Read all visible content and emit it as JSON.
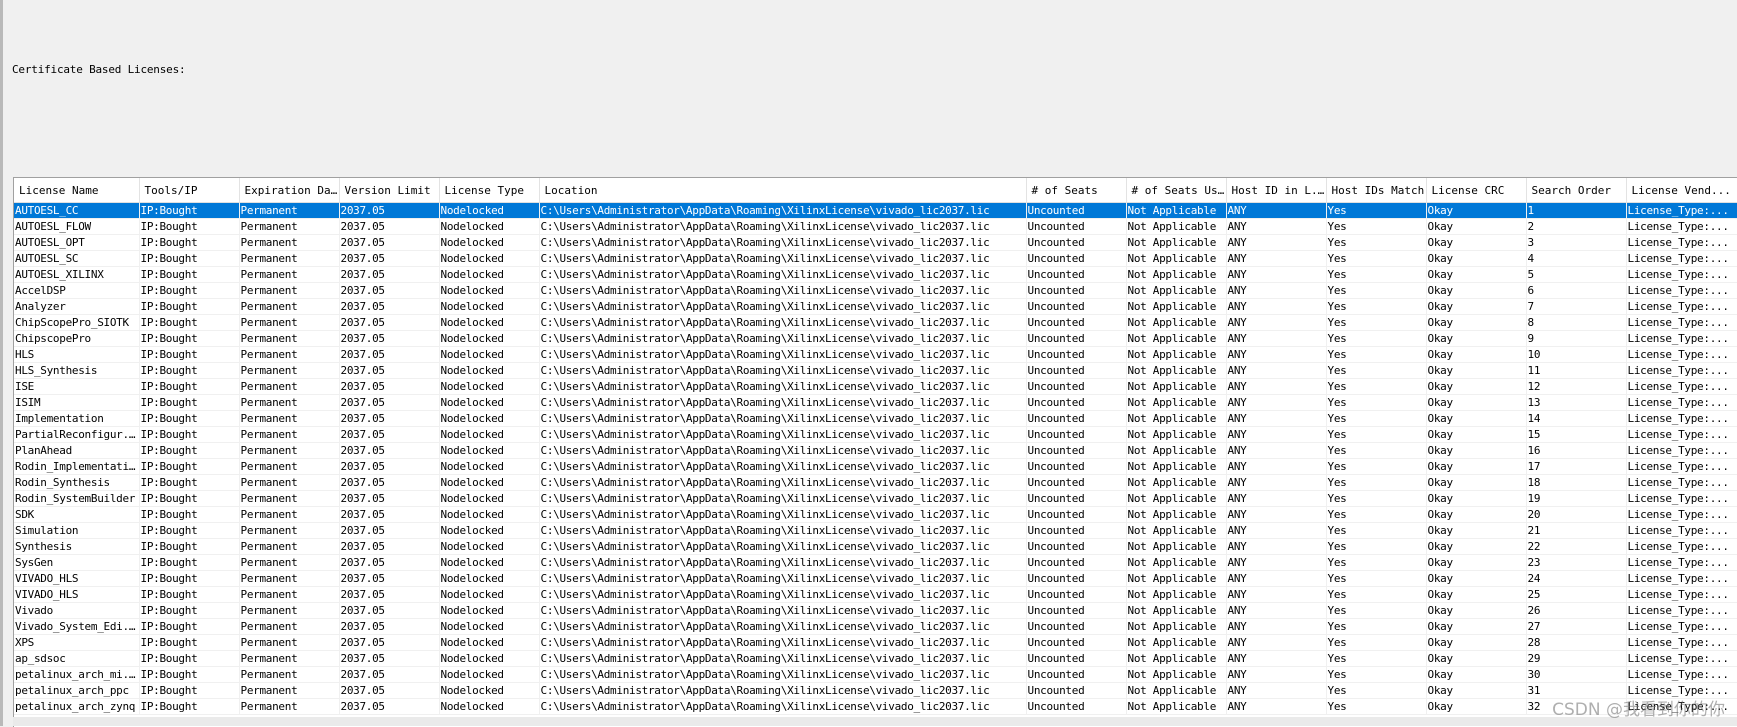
{
  "section_label": "Certificate Based Licenses:",
  "columns": [
    "License Name",
    "Tools/IP",
    "Expiration Date",
    "Version Limit",
    "License Type",
    "Location",
    "# of Seats",
    "# of Seats Used",
    "Host ID in L...",
    "Host IDs Match",
    "License CRC",
    "Search Order",
    "License Vend..."
  ],
  "row_defaults": {
    "tools": "IP:Bought",
    "expiration": "Permanent",
    "version": "2037.05",
    "type": "Nodelocked",
    "location": "C:\\Users\\Administrator\\AppData\\Roaming\\XilinxLicense\\vivado_lic2037.lic",
    "seats": "Uncounted",
    "seats_used": "Not Applicable",
    "host_id": "ANY",
    "host_match": "Yes",
    "crc": "Okay",
    "vendor": "License_Type:..."
  },
  "rows": [
    {
      "name": "AUTOESL_CC",
      "order": "1",
      "selected": true
    },
    {
      "name": "AUTOESL_FLOW",
      "order": "2"
    },
    {
      "name": "AUTOESL_OPT",
      "order": "3"
    },
    {
      "name": "AUTOESL_SC",
      "order": "4"
    },
    {
      "name": "AUTOESL_XILINX",
      "order": "5"
    },
    {
      "name": "AccelDSP",
      "order": "6"
    },
    {
      "name": "Analyzer",
      "order": "7"
    },
    {
      "name": "ChipScopePro_SIOTK",
      "order": "8"
    },
    {
      "name": "ChipscopePro",
      "order": "9"
    },
    {
      "name": "HLS",
      "order": "10"
    },
    {
      "name": "HLS_Synthesis",
      "order": "11"
    },
    {
      "name": "ISE",
      "order": "12"
    },
    {
      "name": "ISIM",
      "order": "13"
    },
    {
      "name": "Implementation",
      "order": "14"
    },
    {
      "name": "PartialReconfigur...",
      "order": "15"
    },
    {
      "name": "PlanAhead",
      "order": "16"
    },
    {
      "name": "Rodin_Implementation",
      "order": "17"
    },
    {
      "name": "Rodin_Synthesis",
      "order": "18"
    },
    {
      "name": "Rodin_SystemBuilder",
      "order": "19"
    },
    {
      "name": "SDK",
      "order": "20"
    },
    {
      "name": "Simulation",
      "order": "21"
    },
    {
      "name": "Synthesis",
      "order": "22"
    },
    {
      "name": "SysGen",
      "order": "23"
    },
    {
      "name": "VIVADO_HLS",
      "order": "24"
    },
    {
      "name": "VIVADO_HLS",
      "order": "25"
    },
    {
      "name": "Vivado",
      "order": "26"
    },
    {
      "name": "Vivado_System_Edi...",
      "order": "27"
    },
    {
      "name": "XPS",
      "order": "28"
    },
    {
      "name": "ap_sdsoc",
      "order": "29"
    },
    {
      "name": "petalinux_arch_mi...",
      "order": "30"
    },
    {
      "name": "petalinux_arch_ppc",
      "order": "31"
    },
    {
      "name": "petalinux_arch_zynq",
      "order": "32"
    }
  ],
  "watermark": "CSDN @我看到你的你",
  "colors": {
    "selection": "#0078d7",
    "background": "#f0f0f0"
  }
}
